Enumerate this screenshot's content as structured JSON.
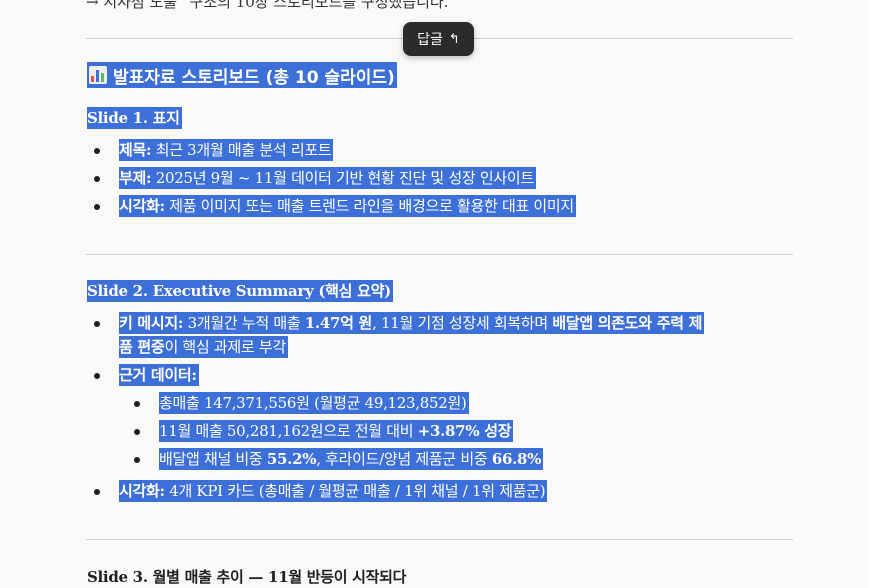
{
  "top_line": "→ 시사점 도출” 구조의 10장 스토리보드를 구성했습니다.",
  "reply_button": {
    "label": "답글",
    "icon": "reply-arrow-icon"
  },
  "heading": "발표자료 스토리보드 (총 10 슬라이드)",
  "heading_icon": "bar-chart-icon",
  "slide1": {
    "title": "Slide 1. 표지",
    "items": [
      {
        "label": "제목:",
        "text": " 최근 3개월 매출 분석 리포트"
      },
      {
        "label": "부제:",
        "text": " 2025년 9월 ~ 11월 데이터 기반 현황 진단 및 성장 인사이트"
      },
      {
        "label": "시각화:",
        "text": " 제품 이미지 또는 매출 트렌드 라인을 배경으로 활용한 대표 이미지"
      }
    ]
  },
  "slide2": {
    "title": "Slide 2. Executive Summary (핵심 요약)",
    "key_message": {
      "label": "키 메시지:",
      "t1": " 3개월간 누적 매출 ",
      "b1": "1.47억 원",
      "t2": ", 11월 기점 성장세 회복하며 ",
      "b2": "배달앱 의존도와 주력 제",
      "b3": "품 편중",
      "t3": "이 핵심 과제로 부각"
    },
    "evidence_label": "근거 데이터:",
    "evidence": {
      "e1": "총매출 147,371,556원 (월평균 49,123,852원)",
      "e2_t": "11월 매출 50,281,162원으로 전월 대비 ",
      "e2_b": "+3.87% 성장",
      "e3_t1": "배달앱 채널 비중 ",
      "e3_b1": "55.2%",
      "e3_t2": ", 후라이드/양념 제품군 비중 ",
      "e3_b2": "66.8%"
    },
    "visual": {
      "label": "시각화:",
      "text": " 4개 KPI 카드 (총매출 / 월평균 매출 / 1위 채널 / 1위 제품군)"
    }
  },
  "slide3": {
    "title": "Slide 3. 월별 매출 추이 — 11월 반등이 시작되다"
  }
}
